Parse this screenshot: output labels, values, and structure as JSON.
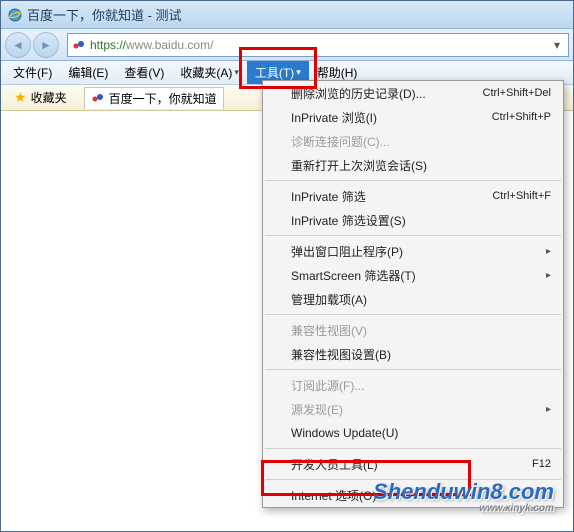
{
  "titlebar": {
    "title": "百度一下，你就知道 - 测试"
  },
  "url": {
    "protocol": "https://",
    "rest": "www.baidu.com/"
  },
  "menu": {
    "file": "文件(F)",
    "edit": "编辑(E)",
    "view": "查看(V)",
    "favorites": "收藏夹(A)",
    "tools": "工具(T)",
    "help": "帮助(H)"
  },
  "favbar": {
    "label": "收藏夹",
    "tab": "百度一下，你就知道"
  },
  "dropdown": {
    "delete_history": "删除浏览的历史记录(D)...",
    "delete_history_sc": "Ctrl+Shift+Del",
    "inprivate_browse": "InPrivate 浏览(I)",
    "inprivate_browse_sc": "Ctrl+Shift+P",
    "diagnose": "诊断连接问题(C)...",
    "reopen": "重新打开上次浏览会话(S)",
    "inprivate_filter": "InPrivate 筛选",
    "inprivate_filter_sc": "Ctrl+Shift+F",
    "inprivate_filter_settings": "InPrivate 筛选设置(S)",
    "popup_blocker": "弹出窗口阻止程序(P)",
    "smartscreen": "SmartScreen 筛选器(T)",
    "manage_addons": "管理加载项(A)",
    "compat_view": "兼容性视图(V)",
    "compat_view_settings": "兼容性视图设置(B)",
    "feed_sub": "订阅此源(F)...",
    "feed_discovery": "源发现(E)",
    "windows_update": "Windows Update(U)",
    "dev_tools": "开发人员工具(L)",
    "dev_tools_sc": "F12",
    "internet_options": "Internet 选项(O)"
  },
  "watermark": {
    "main": "Shenduwin8.com",
    "sub": "www.xinyk.com"
  }
}
